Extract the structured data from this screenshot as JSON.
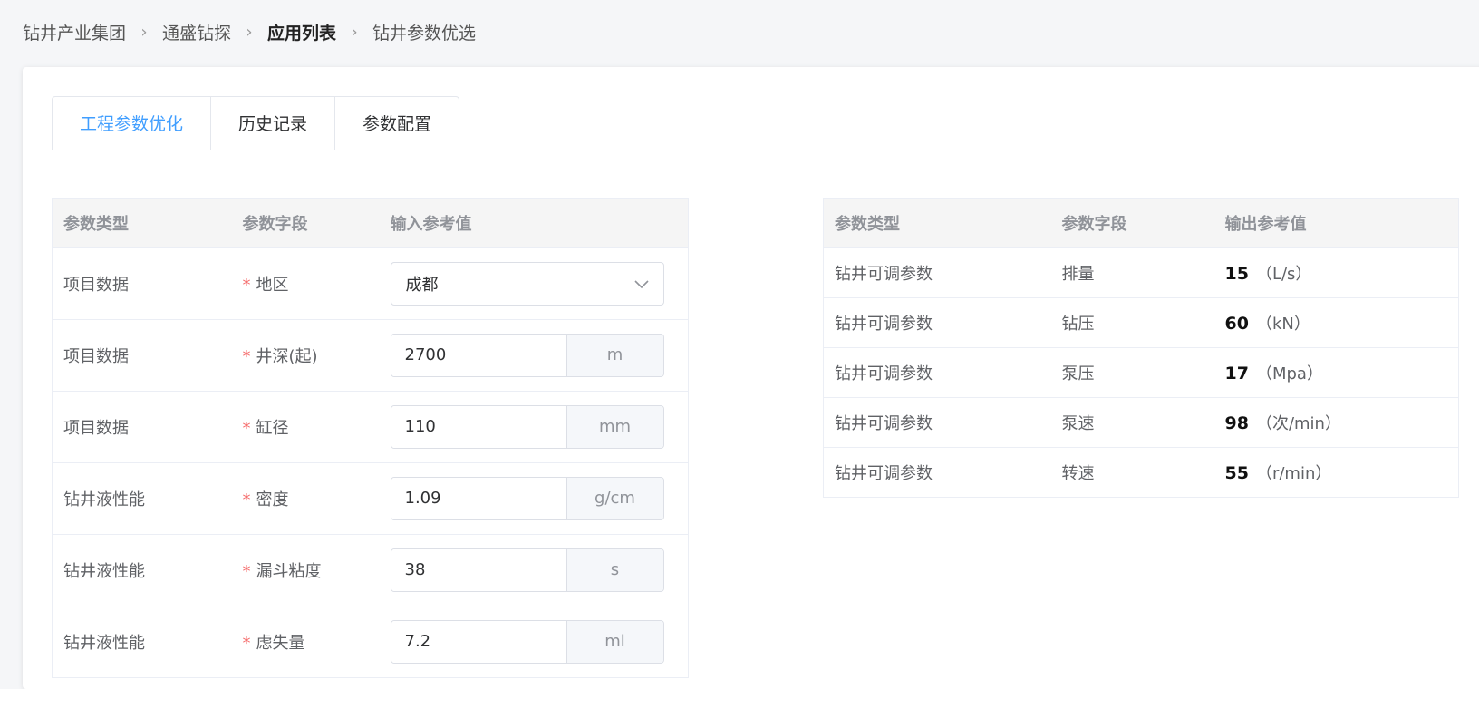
{
  "breadcrumb": [
    {
      "label": "钻井产业集团"
    },
    {
      "label": "通盛钻探"
    },
    {
      "label": "应用列表"
    },
    {
      "label": "钻井参数优选"
    }
  ],
  "tabs": [
    {
      "label": "工程参数优化",
      "active": true
    },
    {
      "label": "历史记录",
      "active": false
    },
    {
      "label": "参数配置",
      "active": false
    }
  ],
  "input_table": {
    "headers": [
      "参数类型",
      "参数字段",
      "输入参考值"
    ],
    "required_mark": "*",
    "rows": [
      {
        "type": "项目数据",
        "field": "地区",
        "value": "成都",
        "unit": "",
        "kind": "select"
      },
      {
        "type": "项目数据",
        "field": "井深(起)",
        "value": "2700",
        "unit": "m"
      },
      {
        "type": "项目数据",
        "field": "缸径",
        "value": "110",
        "unit": "mm"
      },
      {
        "type": "钻井液性能",
        "field": "密度",
        "value": "1.09",
        "unit": "g/cm"
      },
      {
        "type": "钻井液性能",
        "field": "漏斗粘度",
        "value": "38",
        "unit": "s"
      },
      {
        "type": "钻井液性能",
        "field": "虑失量",
        "value": "7.2",
        "unit": "ml"
      }
    ]
  },
  "output_table": {
    "headers": [
      "参数类型",
      "参数字段",
      "输出参考值"
    ],
    "rows": [
      {
        "type": "钻井可调参数",
        "field": "排量",
        "value": "15",
        "unit": "（L/s）"
      },
      {
        "type": "钻井可调参数",
        "field": "钻压",
        "value": "60",
        "unit": "（kN）"
      },
      {
        "type": "钻井可调参数",
        "field": "泵压",
        "value": "17",
        "unit": "（Mpa）"
      },
      {
        "type": "钻井可调参数",
        "field": "泵速",
        "value": "98",
        "unit": "（次/min）"
      },
      {
        "type": "钻井可调参数",
        "field": "转速",
        "value": "55",
        "unit": "（r/min）"
      }
    ]
  },
  "icons": {
    "chevron_down": "chevron-down-icon",
    "arrow_right": "arrow-right-icon",
    "breadcrumb_sep": "›"
  },
  "colors": {
    "accent": "#409eff",
    "required": "#f56c6c"
  }
}
